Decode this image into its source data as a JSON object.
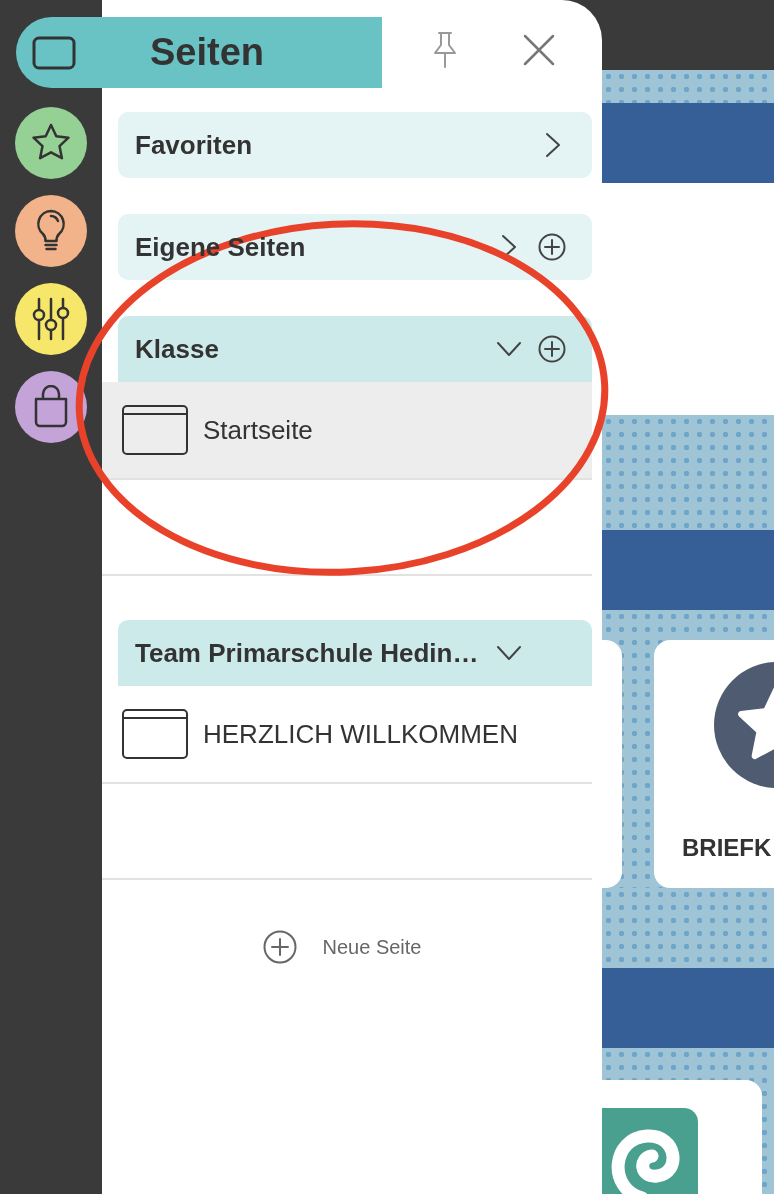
{
  "rail": [
    {
      "kind": "pages",
      "selected": true,
      "color": "#69c2c4"
    },
    {
      "kind": "favorites",
      "selected": false,
      "color": "#95d095"
    },
    {
      "kind": "ideas",
      "selected": false,
      "color": "#f2b28a"
    },
    {
      "kind": "settings",
      "selected": false,
      "color": "#f6e66a"
    },
    {
      "kind": "shop",
      "selected": false,
      "color": "#c3a3d8"
    }
  ],
  "panel": {
    "title": "Seiten",
    "pinned": false
  },
  "sections": [
    {
      "title": "Favoriten",
      "expanded": false,
      "addable": false
    },
    {
      "title": "Eigene Seiten",
      "expanded": false,
      "addable": true
    },
    {
      "title": "Klasse",
      "expanded": true,
      "addable": true,
      "pages": [
        {
          "title": "Startseite",
          "selected": true
        }
      ]
    },
    {
      "title": "Team Primarschule Hedin…",
      "expanded": true,
      "addable": false,
      "pages": [
        {
          "title": "HERZLICH WILLKOMMEN",
          "selected": false
        }
      ]
    }
  ],
  "new_page": "Neue Seite",
  "background_card": {
    "label": "BRIEFK"
  },
  "annotation": {
    "kind": "ellipse",
    "color": "#e8432a"
  }
}
